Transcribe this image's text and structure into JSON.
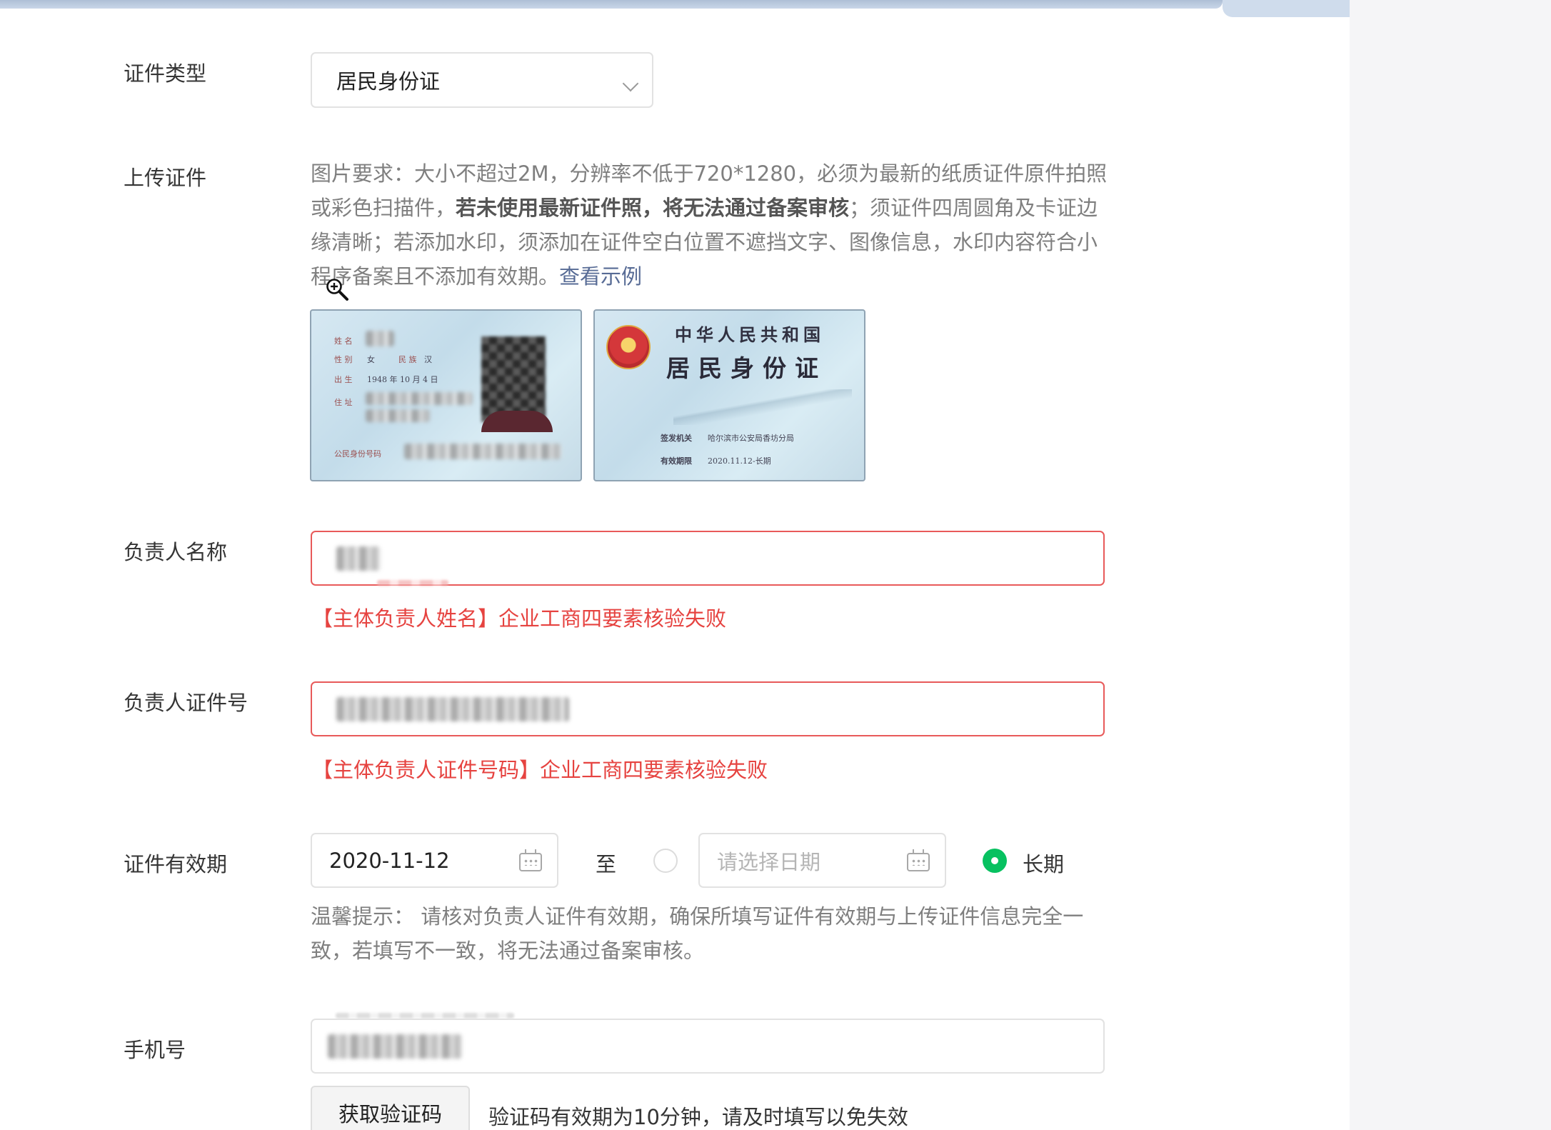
{
  "form": {
    "cert_type": {
      "label": "证件类型",
      "value": "居民身份证"
    },
    "upload": {
      "label": "上传证件",
      "hint_part1": "图片要求：大小不超过2M，分辨率不低于720*1280，必须为最新的纸质证件原件拍照或彩色扫描件，",
      "hint_bold": "若未使用最新证件照，将无法通过备案审核",
      "hint_part2": "；须证件四周圆角及卡证边缘清晰；若添加水印，须添加在证件空白位置不遮挡文字、图像信息，水印内容符合小程序备案且不添加有效期。",
      "example_link": "查看示例",
      "front": {
        "name_label": "姓 名",
        "gender_label": "性 别",
        "gender": "女",
        "ethnicity_label": "民 族",
        "ethnicity": "汉",
        "birth_label": "出 生",
        "birth": "1948 年 10 月 4 日",
        "address_label": "住 址",
        "id_label": "公民身份号码"
      },
      "back": {
        "title1": "中华人民共和国",
        "title2": "居民身份证",
        "authority_label": "签发机关",
        "authority": "哈尔滨市公安局香坊分局",
        "validity_label": "有效期限",
        "validity": "2020.11.12-长期"
      }
    },
    "name": {
      "label": "负责人名称",
      "error": "【主体负责人姓名】企业工商四要素核验失败"
    },
    "id_number": {
      "label": "负责人证件号",
      "error": "【主体负责人证件号码】企业工商四要素核验失败"
    },
    "validity": {
      "label": "证件有效期",
      "start": "2020-11-12",
      "to": "至",
      "end_placeholder": "请选择日期",
      "long_term": "长期",
      "hint": "温馨提示： 请核对负责人证件有效期，确保所填写证件有效期与上传证件信息完全一致，若填写不一致，将无法通过备案审核。"
    },
    "phone": {
      "label": "手机号",
      "get_code": "获取验证码",
      "code_hint": "验证码有效期为10分钟，请及时填写以免失效"
    }
  },
  "colors": {
    "error": "#e64340",
    "link": "#576b95",
    "accent": "#07c160"
  }
}
